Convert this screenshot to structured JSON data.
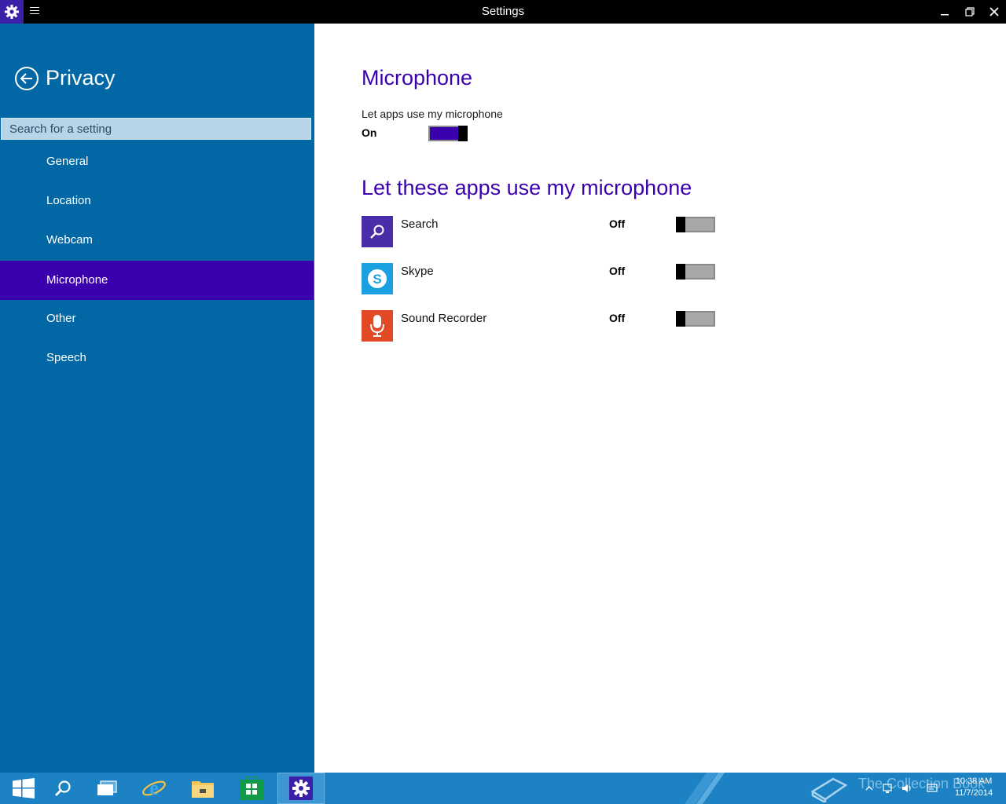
{
  "window": {
    "title": "Settings"
  },
  "sidebar": {
    "title": "Privacy",
    "search_placeholder": "Search for a setting",
    "items": [
      {
        "label": "General",
        "active": false
      },
      {
        "label": "Location",
        "active": false
      },
      {
        "label": "Webcam",
        "active": false
      },
      {
        "label": "Microphone",
        "active": true
      },
      {
        "label": "Other",
        "active": false
      },
      {
        "label": "Speech",
        "active": false
      }
    ]
  },
  "main": {
    "heading": "Microphone",
    "setting_label": "Let apps use my microphone",
    "setting_state": "On",
    "apps_heading": "Let these apps use my microphone",
    "apps": [
      {
        "name": "Search",
        "state": "Off",
        "icon": "search-icon",
        "color": "#4b2ca8"
      },
      {
        "name": "Skype",
        "state": "Off",
        "icon": "skype-icon",
        "color": "#1ba1e2"
      },
      {
        "name": "Sound Recorder",
        "state": "Off",
        "icon": "microphone-icon",
        "color": "#e04a24"
      }
    ]
  },
  "taskbar": {
    "watermark": "The Collection Book",
    "clock_time": "10:38 AM",
    "clock_date": "11/7/2014"
  },
  "colors": {
    "accent": "#3a00ad",
    "sidebar_bg": "#0168a5",
    "taskbar_bg": "#1d82c3"
  }
}
